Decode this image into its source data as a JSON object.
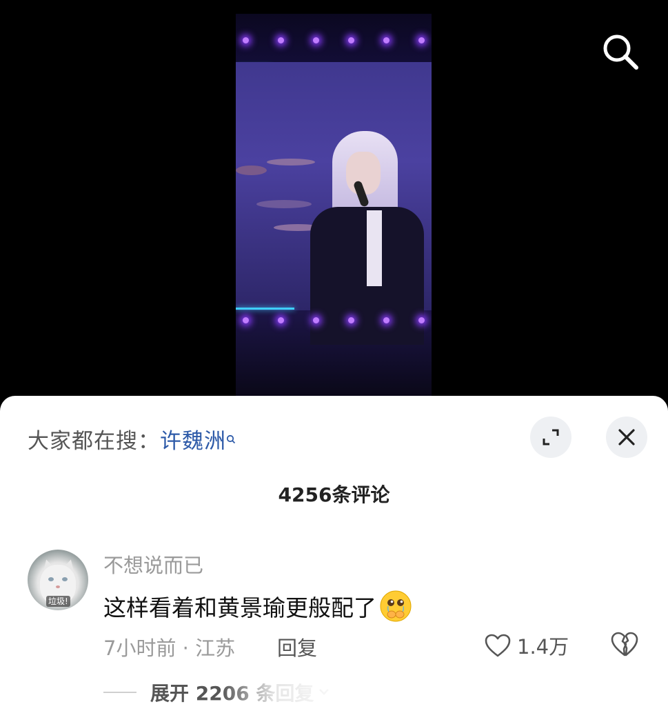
{
  "header": {
    "search_icon": "search-icon"
  },
  "sheet": {
    "hot_search_prefix": "大家都在搜：",
    "hot_search_keyword": "许魏洲",
    "expand_icon": "expand-icon",
    "close_icon": "close-icon",
    "comment_count_title": "4256条评论"
  },
  "comment": {
    "avatar_caption": "垃圾!",
    "username": "不想说而已",
    "text": "这样看着和黄景瑜更般配了",
    "emoji": "crying-holding-back-tears-emoji",
    "time_location": "7小时前 · 江苏",
    "reply_label": "回复",
    "like_count": "1.4万",
    "expand_replies": "展开 2206 条回复"
  },
  "colors": {
    "keyword_blue": "#2d5aa8",
    "muted_gray": "#9a9a9a",
    "text_dark": "#111111"
  }
}
